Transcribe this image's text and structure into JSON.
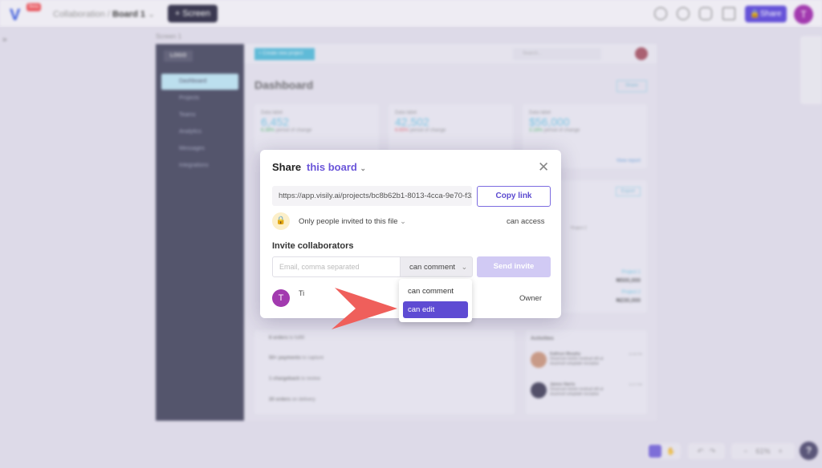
{
  "topbar": {
    "beta": "Beta",
    "breadcrumb_project": "Collaboration",
    "breadcrumb_sep": "/",
    "board": "Board 1",
    "add_screen": "+ Screen",
    "share": "Share",
    "avatar": "T"
  },
  "canvas": {
    "screen_label": "Screen 1",
    "logo": "LOGO",
    "create": "+ Create new project",
    "search_placeholder": "Search...",
    "title": "Dashboard",
    "share": "Share",
    "nav": [
      "Dashboard",
      "Projects",
      "Teams",
      "Analytics",
      "Messages",
      "Integrations"
    ],
    "stats": [
      {
        "label": "Data label",
        "value": "6,452",
        "delta": "6.38%",
        "suffix": "period of change",
        "color": "#3cb55a"
      },
      {
        "label": "Data label",
        "value": "42,502",
        "delta": "6.65%",
        "suffix": "period of change",
        "color": "#e8545c"
      },
      {
        "label": "Data label",
        "value": "$56,000",
        "delta": "3.16%",
        "suffix": "period of change",
        "color": "#3cb55a"
      }
    ],
    "view_report": "View report",
    "export": "Export",
    "legend": "Project 2",
    "projects": [
      {
        "name": "Project 1",
        "value": "₦500,000"
      },
      {
        "name": "Project 2",
        "value": "₦230,000"
      }
    ],
    "tasks": [
      {
        "bold": "6 orders",
        "rest": "to fulfill"
      },
      {
        "bold": "50+ payments",
        "rest": "to capture"
      },
      {
        "bold": "1 chargeback",
        "rest": "to review"
      },
      {
        "bold": "20 orders",
        "rest": "on delivery"
      }
    ],
    "activities_title": "Activities",
    "activities": [
      {
        "name": "Kathryn Murphy",
        "time": "12:45 PM",
        "text": "Deserunt minim nostrud elit ut eiusmod voluptate exceptur"
      },
      {
        "name": "James Harris",
        "time": "11:27 PM",
        "text": "Deserunt minim nostrud elit ut eiusmod voluptate exceptur"
      }
    ]
  },
  "modal": {
    "title": "Share",
    "scope": "this board",
    "url": "https://app.visily.ai/projects/bc8b62b1-8013-4cca-9e70-f32",
    "copy_link": "Copy link",
    "access": "Only people invited to this file",
    "can_access": "can access",
    "invite_title": "Invite collaborators",
    "email_placeholder": "Email, comma separated",
    "permission": "can comment",
    "send": "Send invite",
    "user_initial": "T",
    "user_name": "Ti",
    "user_role": "Owner",
    "options": [
      "can comment",
      "can edit"
    ],
    "selected_option": "can edit"
  },
  "bottom": {
    "zoom": "61%",
    "help": "?"
  },
  "colors": {
    "accent": "#6552d8",
    "arrow": "#ef5f5b",
    "sidebar": "#2e3049"
  }
}
